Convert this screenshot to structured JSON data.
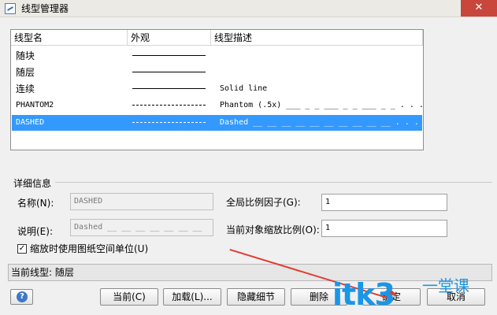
{
  "window": {
    "title": "线型管理器",
    "close_label": "✕"
  },
  "list": {
    "columns": [
      "线型名",
      "外观",
      "线型描述"
    ],
    "rows": [
      {
        "name": "随块",
        "pattern": "solid",
        "description": ""
      },
      {
        "name": "随层",
        "pattern": "solid",
        "description": ""
      },
      {
        "name": "连续",
        "pattern": "solid",
        "description": "Solid line"
      },
      {
        "name": "PHANTOM2",
        "pattern": "phantom",
        "description": "Phantom (.5x) ___ _ _ ___ _ _ ___ _ _ . . ."
      },
      {
        "name": "DASHED",
        "pattern": "dashed",
        "description": "Dashed __ __ __ __ __ __ __ __ __ __ . . .",
        "selected": true
      }
    ]
  },
  "details": {
    "group_label": "详细信息",
    "name_label": "名称(N):",
    "name_value": "DASHED",
    "desc_label": "说明(E):",
    "desc_value": "Dashed __ __ __ __ __ __ __ __ __",
    "global_scale_label": "全局比例因子(G):",
    "global_scale_value": "1",
    "object_scale_label": "当前对象缩放比例(O):",
    "object_scale_value": "1",
    "paper_space_label": "缩放时使用图纸空间单位(U)",
    "paper_space_checked": "✓"
  },
  "status": {
    "current_linetype": "当前线型: 随层"
  },
  "buttons": {
    "help": "?",
    "current": "当前(C)",
    "load": "加载(L)...",
    "hide_details": "隐藏细节",
    "delete": "删除",
    "ok": "确定",
    "cancel": "取消"
  },
  "watermark": {
    "text": "itk3",
    "sub": "一堂课"
  },
  "colors": {
    "selection": "#3399ff",
    "close": "#c9463d",
    "watermark": "#1a96e8",
    "arrow": "#e23b33"
  }
}
